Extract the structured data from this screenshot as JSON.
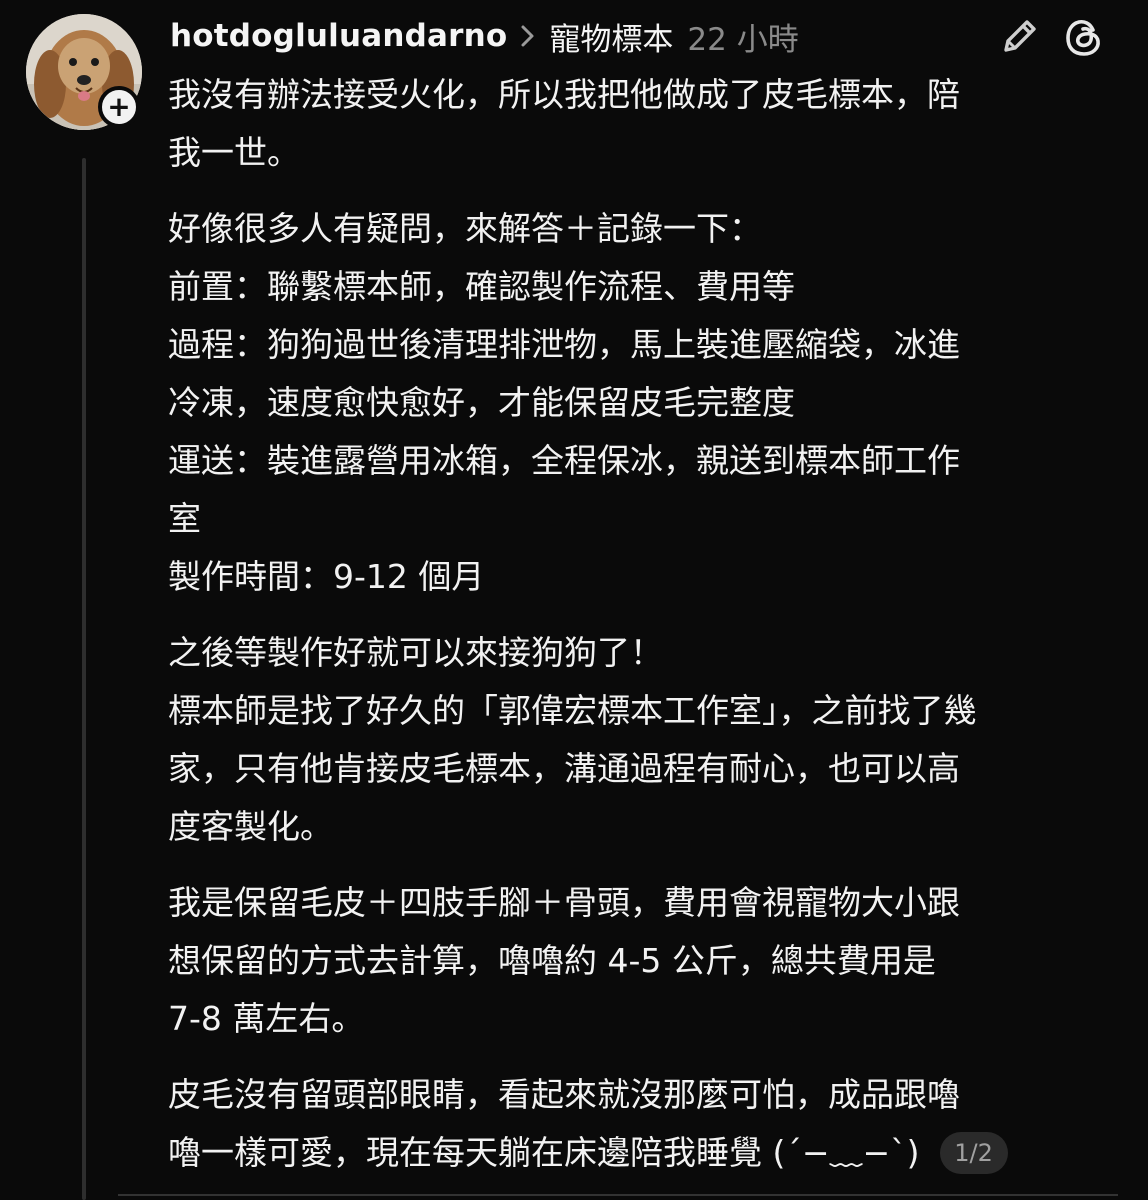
{
  "post": {
    "username": "hotdogluluandarno",
    "topic": "寵物標本",
    "time": "22 小時",
    "icons": {
      "avatar": "dog-avatar",
      "follow": "plus-icon",
      "separator": "chevron-right-icon",
      "edit": "pencil-icon",
      "app": "threads-logo-icon"
    },
    "paragraphs": [
      {
        "lines": [
          "我沒有辦法接受火化，所以我把他做成了皮毛標本，陪",
          "我一世。"
        ]
      },
      {
        "lines": [
          "好像很多人有疑問，來解答＋記錄一下：",
          "前置：聯繫標本師，確認製作流程、費用等",
          "過程：狗狗過世後清理排泄物，馬上裝進壓縮袋，冰進",
          "冷凍，速度愈快愈好，才能保留皮毛完整度",
          "運送：裝進露營用冰箱，全程保冰，親送到標本師工作",
          "室",
          "製作時間：9-12 個月"
        ]
      },
      {
        "lines": [
          "之後等製作好就可以來接狗狗了！",
          "標本師是找了好久的「郭偉宏標本工作室」，之前找了幾",
          "家，只有他肯接皮毛標本，溝通過程有耐心，也可以高",
          "度客製化。"
        ]
      },
      {
        "lines": [
          "我是保留毛皮＋四肢手腳＋骨頭，費用會視寵物大小跟",
          "想保留的方式去計算，嚕嚕約 4-5 公斤，總共費用是",
          "7-8 萬左右。"
        ]
      },
      {
        "lines": [
          "皮毛沒有留頭部眼睛，看起來就沒那麼可怕，成品跟嚕"
        ],
        "last_line": "嚕一樣可愛，現在每天躺在床邊陪我睡覺 (´−﹏−`)"
      }
    ],
    "page_indicator": "1/2"
  },
  "colors": {
    "background": "#0a0a0a",
    "text": "#f2f2f2",
    "muted": "#8a8a8a",
    "thread_line": "#2e2e2e",
    "badge_bg": "#2a2a2a"
  }
}
